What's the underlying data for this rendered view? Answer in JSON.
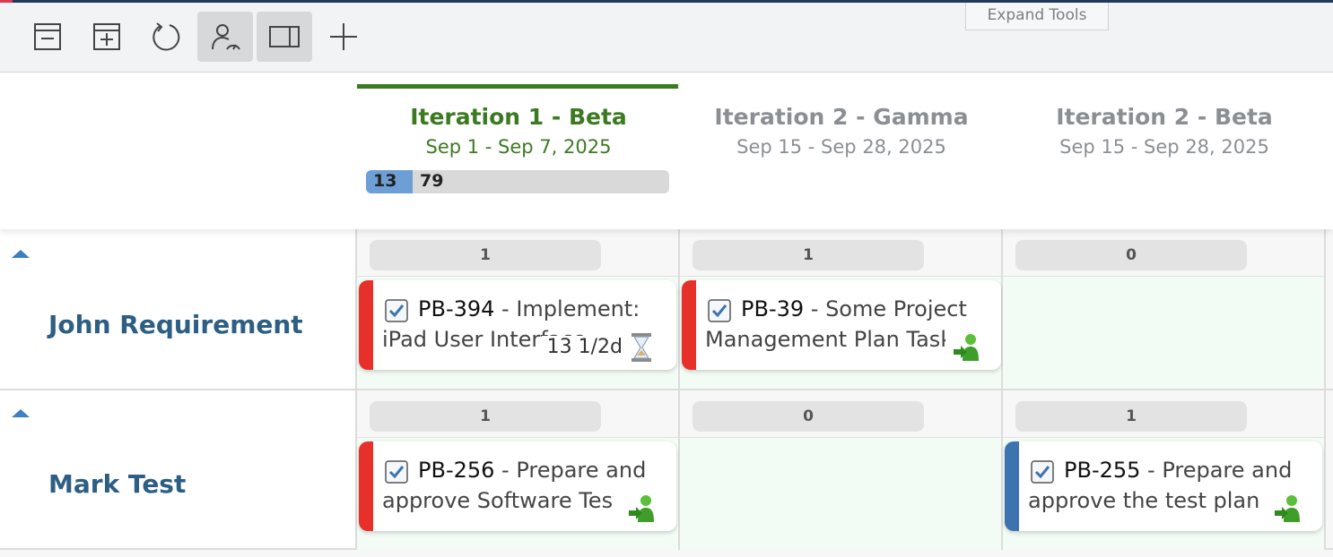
{
  "toolbar": {
    "expand_tools_label": "Expand Tools",
    "buttons": [
      {
        "icon": "collapse-all-icon"
      },
      {
        "icon": "expand-all-icon"
      },
      {
        "icon": "refresh-icon"
      },
      {
        "icon": "user-load-icon",
        "active": true
      },
      {
        "icon": "split-view-icon",
        "active": true
      },
      {
        "icon": "plus-icon"
      }
    ]
  },
  "iterations": [
    {
      "name": "Iteration 1 - Beta",
      "dates": "Sep 1 - Sep 7, 2025",
      "current": true,
      "progress": {
        "done": "13",
        "total": "79",
        "fraction": 0.154
      }
    },
    {
      "name": "Iteration 2 - Gamma",
      "dates": "Sep 15 - Sep 28, 2025",
      "current": false
    },
    {
      "name": "Iteration 2 - Beta",
      "dates": "Sep 15 - Sep 28, 2025",
      "current": false
    }
  ],
  "rows": [
    {
      "name": "John Requirement",
      "counts": [
        "1",
        "1",
        "0"
      ],
      "cards": [
        {
          "id": "PB-394",
          "sep": " - ",
          "title1": "Implement:",
          "title2": "iPad User Interface",
          "estimate": "13 1/2d",
          "stripe": "#e8302a",
          "icon": "hourglass-icon"
        },
        {
          "id": "PB-39",
          "sep": " - ",
          "title1": "Some Project",
          "title2": "Management Plan Task",
          "stripe": "#e8302a",
          "icon": "assign-user-icon"
        }
      ]
    },
    {
      "name": "Mark Test",
      "counts": [
        "1",
        "0",
        "1"
      ],
      "cards": [
        {
          "id": "PB-256",
          "sep": " - ",
          "title1": "Prepare and",
          "title2": "approve Software Test",
          "stripe": "#e8302a",
          "icon": "assign-user-icon"
        },
        {
          "id": "PB-255",
          "sep": " - ",
          "title1": "Prepare and",
          "title2": "approve the test plan",
          "stripe": "#3d74b0",
          "icon": "assign-user-icon"
        }
      ]
    }
  ]
}
